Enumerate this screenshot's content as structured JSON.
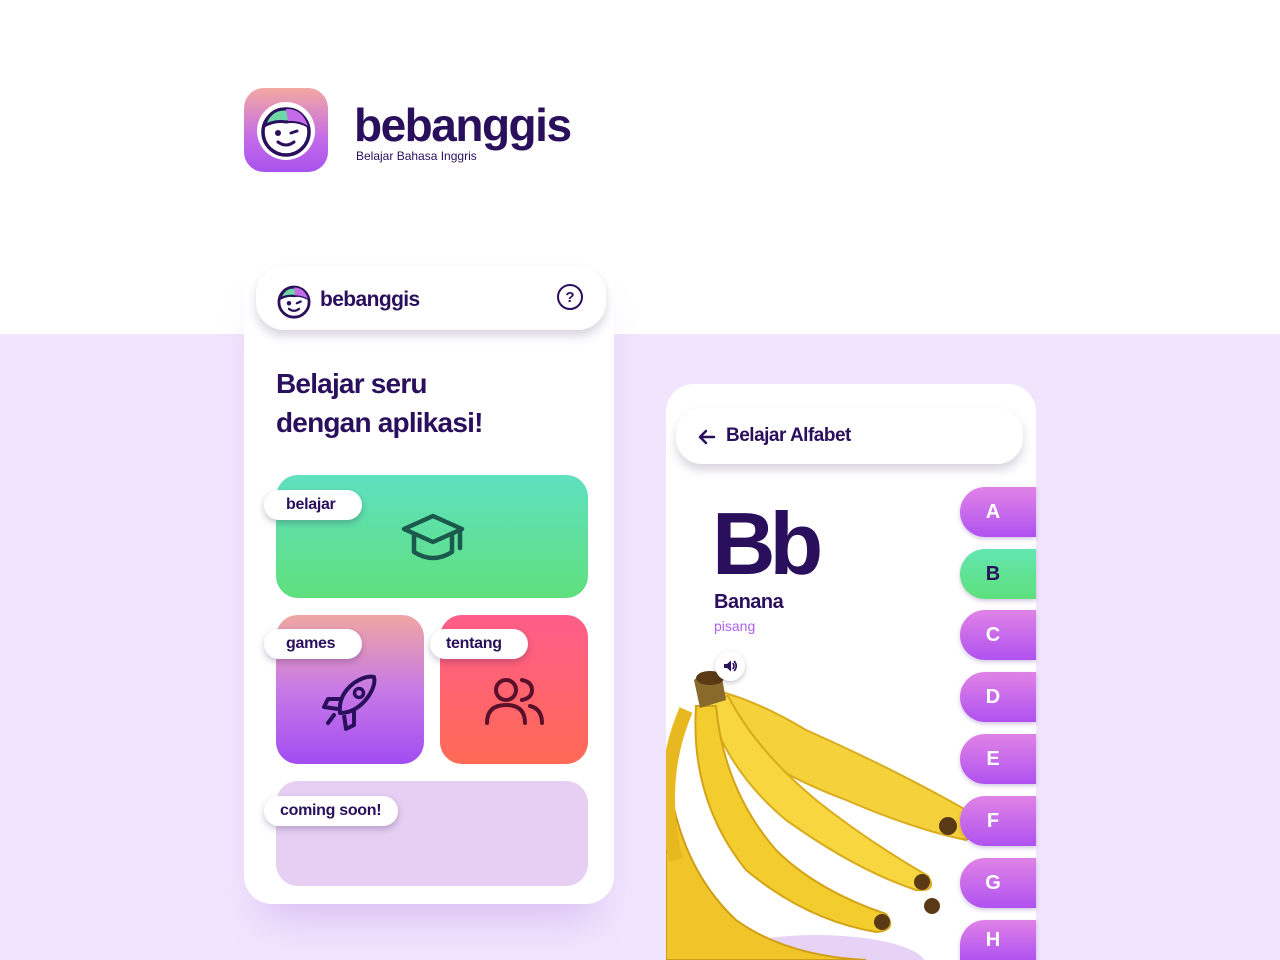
{
  "brand": {
    "name": "bebanggis",
    "tagline": "Belajar Bahasa Inggris"
  },
  "home_screen": {
    "header_title": "bebanggis",
    "help_icon_glyph": "?",
    "headline_line1": "Belajar seru",
    "headline_line2": "dengan aplikasi!",
    "cards": {
      "belajar": {
        "label": "belajar",
        "icon": "graduation-cap-icon"
      },
      "games": {
        "label": "games",
        "icon": "rocket-icon"
      },
      "tentang": {
        "label": "tentang",
        "icon": "users-icon"
      },
      "coming_soon": {
        "label": "coming soon!"
      }
    }
  },
  "alphabet_screen": {
    "title": "Belajar Alfabet",
    "letter": "Bb",
    "word": "Banana",
    "translation": "pisang",
    "letters": [
      "A",
      "B",
      "C",
      "D",
      "E",
      "F",
      "G",
      "H"
    ],
    "active_letter": "B"
  },
  "colors": {
    "primary_text": "#2a0f5c",
    "accent_purple": "#b052f0",
    "accent_green": "#5fe07c",
    "accent_red": "#ff6a55",
    "background_lavender": "#f1e4fd"
  }
}
